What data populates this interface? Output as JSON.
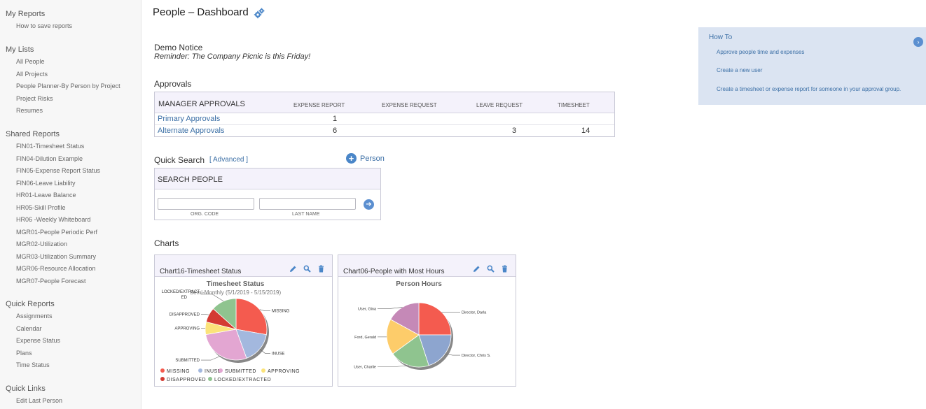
{
  "sidebar": {
    "my_reports": {
      "title": "My Reports",
      "items": [
        "How to save reports"
      ]
    },
    "my_lists": {
      "title": "My Lists",
      "items": [
        "All People",
        "All Projects",
        "People Planner-By Person by Project",
        "Project Risks",
        "Resumes"
      ]
    },
    "shared_reports": {
      "title": "Shared Reports",
      "items": [
        "FIN01-Timesheet Status",
        "FIN04-Dilution Example",
        "FIN05-Expense Report Status",
        "FIN06-Leave Liability",
        "HR01-Leave Balance",
        "HR05-Skill Profile",
        "HR06 -Weekly Whiteboard",
        "MGR01-People Periodic Perf",
        "MGR02-Utilization",
        "MGR03-Utilization Summary",
        "MGR06-Resource Allocation",
        "MGR07-People Forecast"
      ]
    },
    "quick_reports": {
      "title": "Quick Reports",
      "items": [
        "Assignments",
        "Calendar",
        "Expense Status",
        "Plans",
        "Time Status"
      ]
    },
    "quick_links": {
      "title": "Quick Links",
      "items": [
        "Edit Last Person"
      ]
    }
  },
  "header": {
    "title": "People – Dashboard",
    "settings_icon": "gears-icon"
  },
  "notice": {
    "title": "Demo Notice",
    "text": "Reminder: The Company Picnic is this Friday!"
  },
  "approvals": {
    "section_title": "Approvals",
    "table_title": "MANAGER APPROVALS",
    "columns": [
      "EXPENSE REPORT",
      "EXPENSE REQUEST",
      "LEAVE REQUEST",
      "TIMESHEET"
    ],
    "rows": [
      {
        "label": "Primary Approvals",
        "values": [
          "1",
          "",
          "",
          ""
        ]
      },
      {
        "label": "Alternate Approvals",
        "values": [
          "6",
          "",
          "3",
          "14"
        ]
      }
    ]
  },
  "quick_search": {
    "title": "Quick Search",
    "advanced_link": "[ Advanced ]",
    "person_button": "Person",
    "box_title": "SEARCH PEOPLE",
    "field_labels": [
      "ORG. CODE",
      "LAST NAME"
    ]
  },
  "charts_section": {
    "title": "Charts",
    "cards": [
      {
        "title": "Chart16-Timesheet Status"
      },
      {
        "title": "Chart06-People with Most Hours"
      }
    ]
  },
  "chart_data": [
    {
      "type": "pie",
      "title": "Timesheet Status",
      "subtitle": "Semi-Monthly (5/1/2019 - 5/15/2019)",
      "labels": [
        "MISSING",
        "INUSE",
        "SUBMITTED",
        "APPROVING",
        "DISAPPROVED",
        "LOCKED/EXTRACTED"
      ],
      "slice_labels": [
        "MISSING",
        "INUSE",
        "SUBMITTED",
        "APPROVING",
        "DISAPPROVED",
        "LOCKED/EXTRACT\nED"
      ],
      "values": [
        25,
        15,
        25,
        6,
        7,
        12
      ],
      "colors": [
        "#f45b4f",
        "#a3b8de",
        "#e3a6d2",
        "#fbe37a",
        "#d33a32",
        "#8fc48f"
      ],
      "legend_placement": "bottom"
    },
    {
      "type": "pie",
      "title": "Person Hours",
      "labels": [
        "Director, Darla",
        "Director, Chris S.",
        "User, Charlie",
        "Ford, Gerald",
        "User, Gina"
      ],
      "values": [
        25,
        20,
        20,
        18,
        17
      ],
      "colors": [
        "#f45b4f",
        "#8da5cf",
        "#8fc48f",
        "#fdcc6a",
        "#c589b7"
      ],
      "legend_placement": "none"
    }
  ],
  "howto": {
    "title": "How To",
    "items": [
      "Approve people time and expenses",
      "Create a new user",
      "Create a timesheet or expense report for someone in your approval group."
    ]
  }
}
